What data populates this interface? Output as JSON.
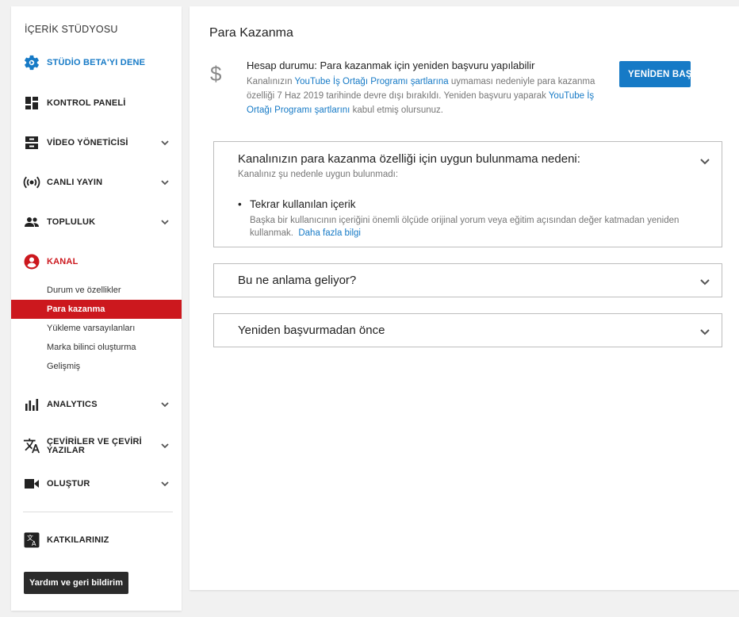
{
  "sidebar": {
    "title": "İÇERİK STÜDYOSU",
    "beta": "STÜDİO BETA'YI DENE",
    "items": {
      "dashboard": "KONTROL PANELİ",
      "video_manager": "VİDEO YÖNETİCİSİ",
      "live": "CANLI YAYIN",
      "community": "TOPLULUK",
      "channel": "KANAL",
      "analytics": "ANALYTICS",
      "translations_line1": "ÇEVİRİLER VE ÇEVİRİ",
      "translations_line2": "YAZILAR",
      "create": "OLUŞTUR",
      "contributions": "KATKILARINIZ"
    },
    "channel_subitems": {
      "status": "Durum ve özellikler",
      "monetization": "Para kazanma",
      "upload_defaults": "Yükleme varsayılanları",
      "branding": "Marka bilinci oluşturma",
      "advanced": "Gelişmiş"
    },
    "help_button": "Yardım ve geri bildirim"
  },
  "main": {
    "title": "Para Kazanma",
    "status": {
      "title": "Hesap durumu: Para kazanmak için yeniden başvuru yapılabilir",
      "desc_part1": "Kanalınızın ",
      "desc_link1": "YouTube İş Ortağı Programı şartlarına",
      "desc_part2": " uymaması nedeniyle para kazanma özelliği 7 Haz 2019 tarihinde devre dışı bırakıldı. Yeniden başvuru yaparak ",
      "desc_link2": "YouTube İş Ortağı Programı şartlarını",
      "desc_part3": " kabul etmiş olursunuz."
    },
    "reapply_button": "YENİDEN BAŞVUR",
    "panels": {
      "reason": {
        "title": "Kanalınızın para kazanma özelliği için uygun bulunmama nedeni:",
        "subtitle": "Kanalınız şu nedenle uygun bulunmadı:",
        "bullet": "•",
        "item_title": "Tekrar kullanılan içerik",
        "item_desc": "Başka bir kullanıcının içeriğini önemli ölçüde orijinal yorum veya eğitim açısından değer katmadan yeniden kullanmak.",
        "item_link": "Daha fazla bilgi"
      },
      "meaning": {
        "title": "Bu ne anlama geliyor?"
      },
      "before": {
        "title": "Yeniden başvurmadan önce"
      }
    }
  },
  "colors": {
    "accent_blue": "#167ac6",
    "accent_red": "#cc181e",
    "dark_button": "#2b2b2b"
  }
}
